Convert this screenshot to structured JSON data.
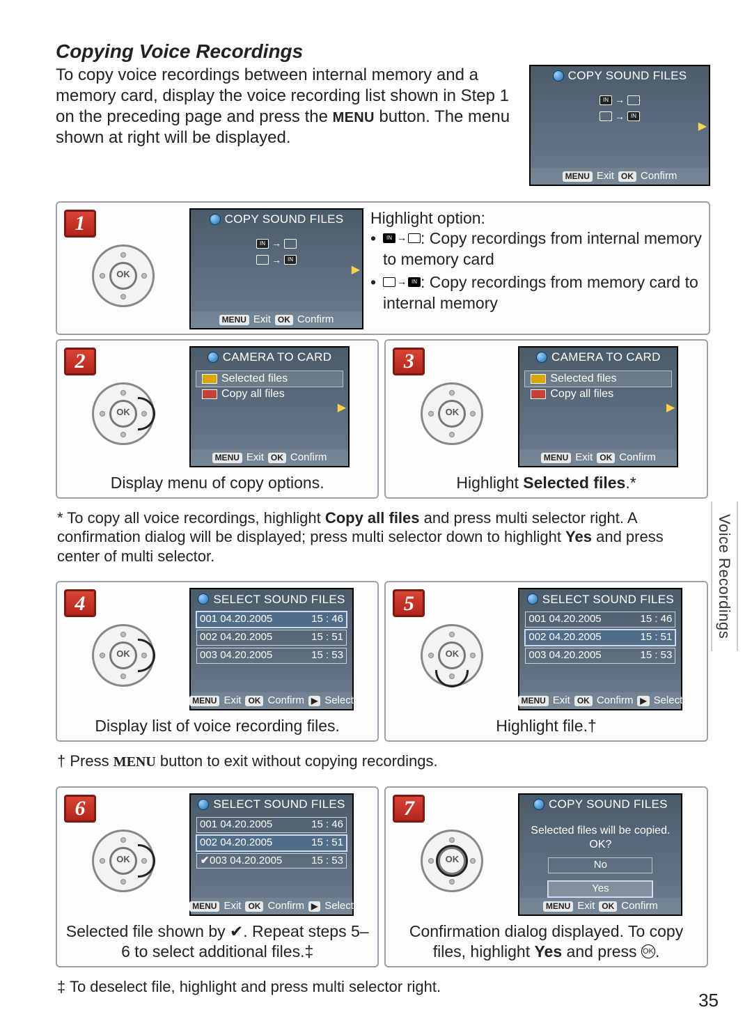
{
  "page": {
    "title": "Copying Voice Recordings",
    "intro_a": "To copy voice recordings between internal memory and a memory card, display the voice recording list shown in Step 1 on the preceding page and press the ",
    "intro_b": "MENU",
    "intro_c": " button.  The menu shown at right will be displayed.",
    "side_tab": "Voice Recordings",
    "page_number": "35"
  },
  "screens": {
    "copy_sound_files": "COPY SOUND FILES",
    "camera_to_card": "CAMERA TO CARD",
    "select_sound_files": "SELECT SOUND FILES",
    "selected_files": "Selected files",
    "copy_all_files": "Copy all files",
    "exit": "Exit",
    "confirm": "Confirm",
    "select": "Select",
    "menu_tag": "MENU",
    "ok_tag": "OK",
    "play_tag": "▶",
    "confirm_q": "Selected files will be copied. OK?",
    "no": "No",
    "yes": "Yes"
  },
  "files": [
    {
      "name": "001 04.20.2005",
      "time": "15 : 46"
    },
    {
      "name": "002 04.20.2005",
      "time": "15 : 51"
    },
    {
      "name": "003 04.20.2005",
      "time": "15 : 53"
    }
  ],
  "steps": {
    "1": {
      "num": "1",
      "heading": "Highlight option:",
      "opt1": ": Copy recordings from internal memory to memory card",
      "opt2": ": Copy recordings from memory card to internal memory"
    },
    "2": {
      "num": "2",
      "caption": "Display menu of copy options."
    },
    "3": {
      "num": "3",
      "caption_a": "Highlight ",
      "caption_b": "Selected files",
      "caption_c": ".*"
    },
    "4": {
      "num": "4",
      "caption": "Display list of voice recording files."
    },
    "5": {
      "num": "5",
      "caption": "Highlight file.†"
    },
    "6": {
      "num": "6",
      "caption": "Selected file shown by ✔.  Repeat steps 5–6 to select additional files.‡"
    },
    "7": {
      "num": "7",
      "caption_a": "Confirmation dialog displayed.  To copy files, highlight ",
      "caption_b": "Yes",
      "caption_c": " and press ",
      "caption_d": "."
    }
  },
  "footnotes": {
    "star_a": "* To copy all voice recordings, highlight ",
    "star_b": "Copy all files",
    "star_c": " and press multi selector right.  A confirmation dialog will be displayed; press multi selector down to highlight ",
    "star_d": "Yes",
    "star_e": " and press center of multi selector.",
    "dagger_a": "† Press ",
    "dagger_b": "MENU",
    "dagger_c": " button to exit without copying recordings.",
    "ddagger": "‡ To deselect file, highlight and press multi selector right."
  }
}
